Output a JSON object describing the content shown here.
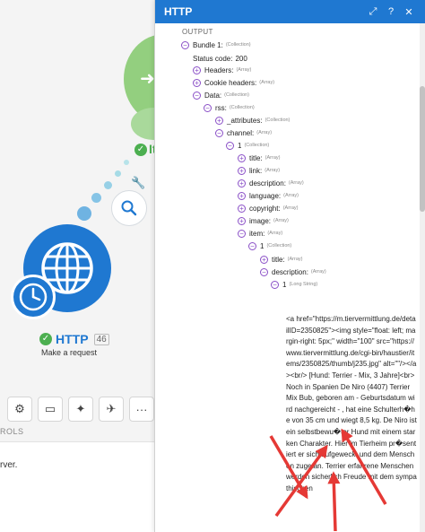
{
  "canvas": {
    "green_module_label": "It",
    "http_module": {
      "name": "HTTP",
      "id": "46",
      "subtitle": "Make a request"
    },
    "controls_label": "ROLS",
    "bottom_text": "rver.",
    "icons": [
      "search-icon",
      "wrench-icon",
      "gear-icon",
      "note-icon",
      "magic-wand-icon",
      "airplane-icon",
      "more-icon"
    ]
  },
  "panel": {
    "title": "HTTP",
    "header_buttons": [
      "expand-icon",
      "help-icon",
      "close-icon"
    ],
    "output_label": "OUTPUT",
    "tree": {
      "bundle": {
        "key": "Bundle 1:",
        "type": "(Collection)"
      },
      "status": {
        "key": "Status code:",
        "value": "200"
      },
      "headers": {
        "key": "Headers:",
        "type": "(Array)"
      },
      "cookie_headers": {
        "key": "Cookie headers:",
        "type": "(Array)"
      },
      "data": {
        "key": "Data:",
        "type": "(Collection)"
      },
      "rss": {
        "key": "rss:",
        "type": "(Collection)"
      },
      "attributes": {
        "key": "_attributes:",
        "type": "(Collection)"
      },
      "channel": {
        "key": "channel:",
        "type": "(Array)"
      },
      "channel_1": {
        "key": "1",
        "type": "(Collection)"
      },
      "title": {
        "key": "title:",
        "type": "(Array)"
      },
      "link": {
        "key": "link:",
        "type": "(Array)"
      },
      "description": {
        "key": "description:",
        "type": "(Array)"
      },
      "language": {
        "key": "language:",
        "type": "(Array)"
      },
      "copyright": {
        "key": "copyright:",
        "type": "(Array)"
      },
      "image": {
        "key": "image:",
        "type": "(Array)"
      },
      "item": {
        "key": "item:",
        "type": "(Array)"
      },
      "item_1": {
        "key": "1",
        "type": "(Collection)"
      },
      "item_title": {
        "key": "title:",
        "type": "(Array)"
      },
      "item_description": {
        "key": "description:",
        "type": "(Array)"
      },
      "desc_1": {
        "key": "1",
        "type": "(Long String)"
      }
    },
    "long_string": "<a href=\"https://m.tiervermittlung.de/detailID=2350825\"><img style=\"float: left; margin-right: 5px;\" width=\"100\" src=\"https://www.tiervermittlung.de/cgi-bin/haustier/items/2350825/thumb/j235.jpg\" alt=\"\"/></a><br/> [Hund: Terrier - Mix, 3 Jahre]<br>Noch in Spanien  De Niro (4407) Terrier Mix Bub, geboren am - Geburtsdatum wird nachgereicht - , hat eine Schulterh�he von 35 cm und wiegt 8,5 kg. De Niro ist ein selbstbewu�ter Hund mit einem starken Charakter. Hier im Tierheim pr�sentiert er sich aufgeweckt und dem Menschen zugetan. Terrier erfahrene Menschen werden sicherlich Freude mit dem sympathischen"
  },
  "colors": {
    "accent": "#1f78d1",
    "toggle": "#8a4fc7",
    "success": "#4caf50",
    "annotation": "#e53935"
  }
}
